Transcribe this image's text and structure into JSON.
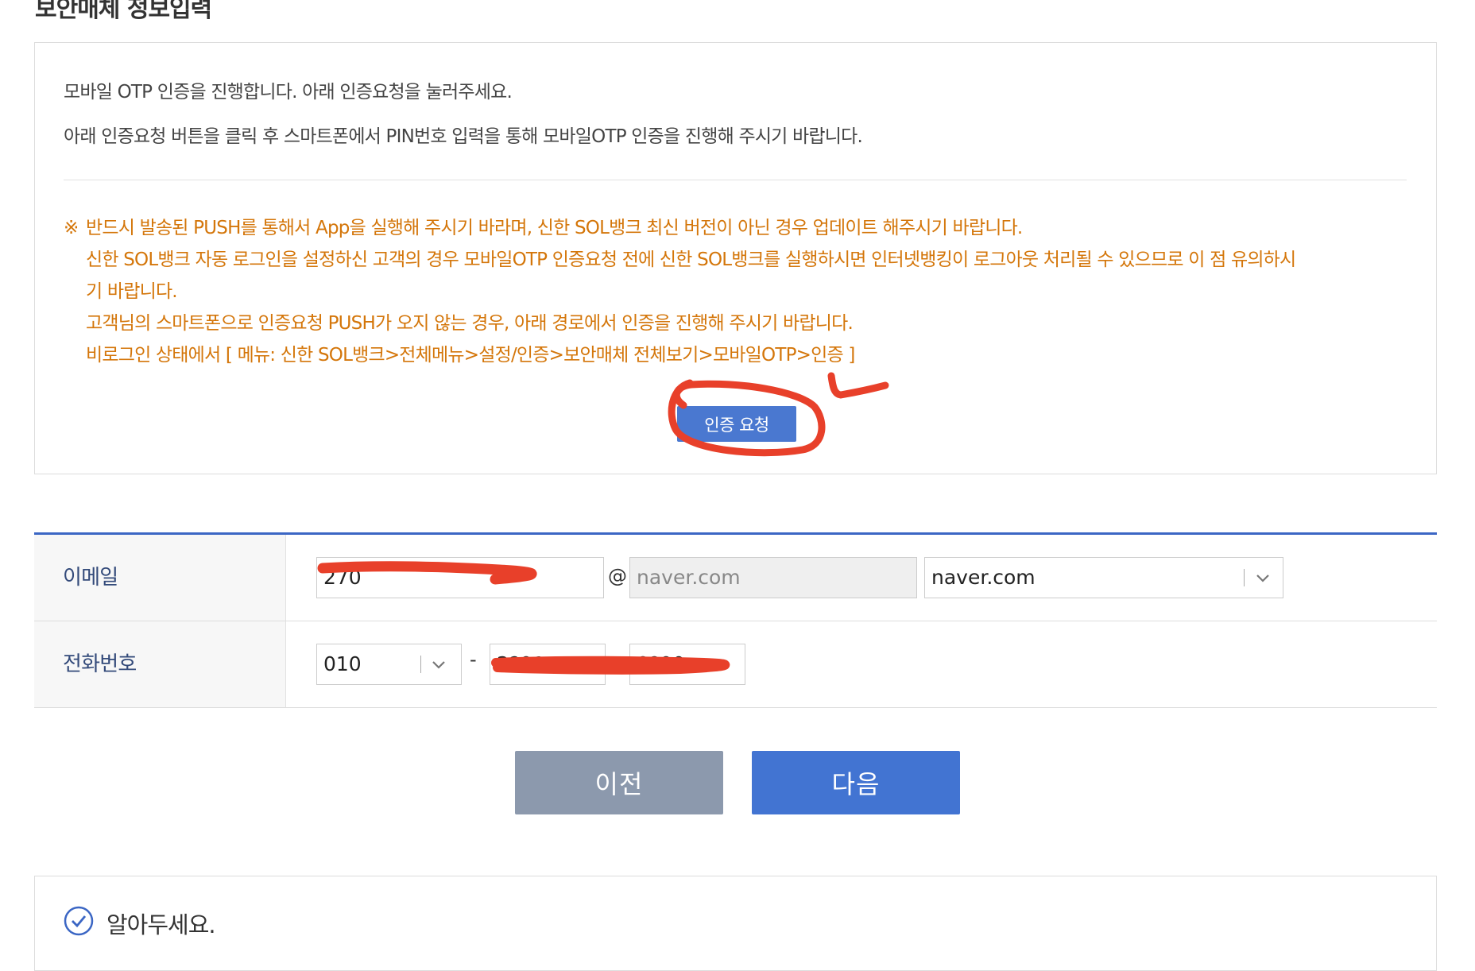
{
  "section_title": "보안매체 정보입력",
  "info": {
    "line1": "모바일 OTP 인증을 진행합니다. 아래 인증요청을 눌러주세요.",
    "line2": "아래 인증요청 버튼을 클릭 후 스마트폰에서 PIN번호 입력을 통해 모바일OTP 인증을 진행해 주시기 바랍니다."
  },
  "notice": {
    "mark": "※",
    "line1": "반드시 발송된 PUSH를 통해서 App을 실행해 주시기 바라며, 신한 SOL뱅크 최신 버전이 아닌 경우 업데이트 해주시기 바랍니다.",
    "line2": "신한 SOL뱅크 자동 로그인을 설정하신 고객의 경우 모바일OTP 인증요청 전에 신한 SOL뱅크를 실행하시면 인터넷뱅킹이 로그아웃 처리될 수 있으므로 이 점 유의하시",
    "line3": "기 바랍니다.",
    "line4": "고객님의 스마트폰으로 인증요청 PUSH가 오지 않는 경우, 아래 경로에서 인증을 진행해 주시기 바랍니다.",
    "line5": "비로그인 상태에서 [ 메뉴: 신한 SOL뱅크>전체메뉴>설정/인증>보안매체 전체보기>모바일OTP>인증 ]"
  },
  "auth_button": "인증 요청",
  "annotation_color": "#e8402a",
  "form": {
    "email": {
      "label": "이메일",
      "local_part": "270",
      "at": "@",
      "domain_value": "naver.com",
      "domain_select": "naver.com"
    },
    "phone": {
      "label": "전화번호",
      "prefix": "010",
      "separator": "-",
      "middle": "2?01",
      "last": "0?00"
    }
  },
  "buttons": {
    "prev": "이전",
    "next": "다음"
  },
  "notice_box": {
    "title": "알아두세요."
  },
  "colors": {
    "primary_blue": "#4274d2",
    "notice_orange": "#d4760a",
    "prev_gray": "#8c99ad"
  },
  "icons": [
    "chevron-down-icon",
    "check-circle-icon"
  ]
}
